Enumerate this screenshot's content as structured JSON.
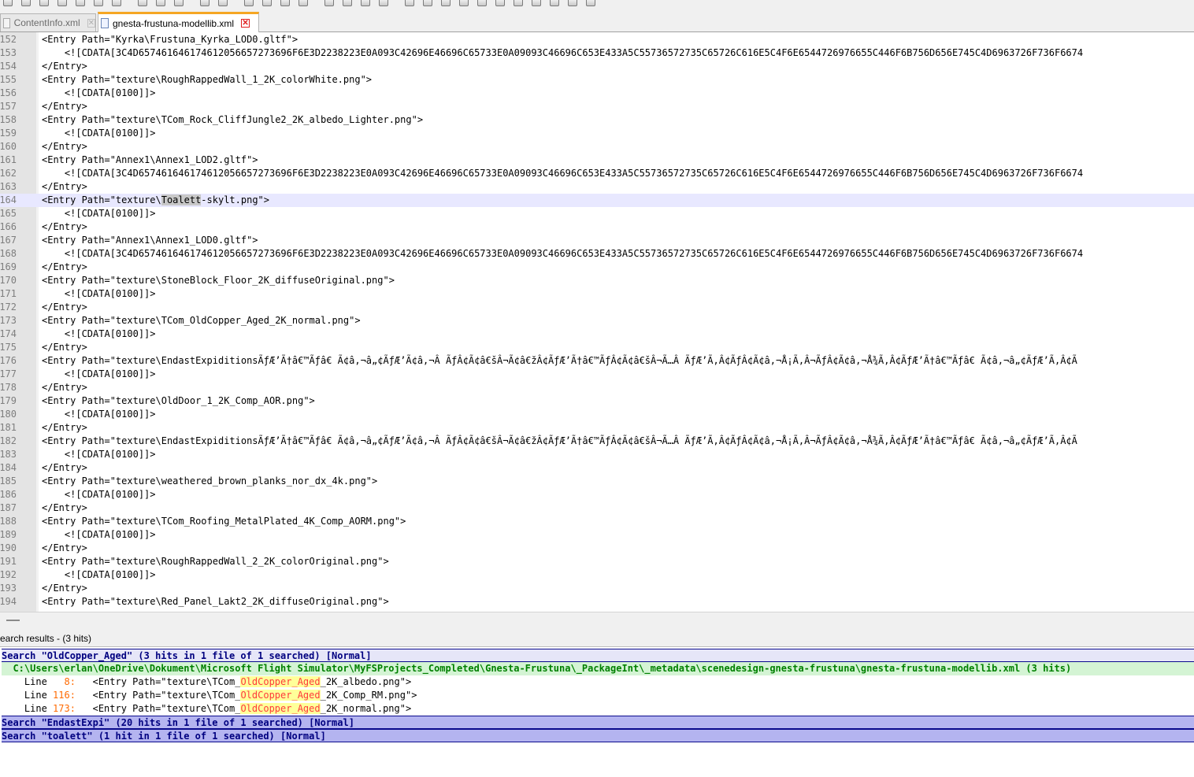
{
  "tabs": [
    {
      "label": "ContentInfo.xml",
      "active": false
    },
    {
      "label": "gnesta-frustuna-modellib.xml",
      "active": true
    }
  ],
  "toolbar_icons": [
    "new-file-icon",
    "open-file-icon",
    "save-icon",
    "save-all-icon",
    "close-icon",
    "close-all-icon",
    "print-icon",
    "cut-icon",
    "copy-icon",
    "paste-icon",
    "undo-icon",
    "redo-icon",
    "find-icon",
    "replace-icon",
    "zoom-in-icon",
    "zoom-out-icon",
    "sync-v-icon",
    "sync-h-icon",
    "word-wrap-icon",
    "all-chars-icon",
    "indent-guide-icon",
    "lang-icon",
    "doc-map-icon",
    "function-list-icon",
    "folder-icon",
    "monitor-icon",
    "record-icon",
    "stop-icon",
    "play-icon",
    "play-multiple-icon",
    "save-macro-icon"
  ],
  "editor": {
    "lines": [
      {
        "num": "152",
        "code": "<Entry Path=\"Kyrka\\Frustuna_Kyrka_LOD0.gltf\">"
      },
      {
        "num": "153",
        "code": "    <![CDATA[3C4D657461646174612056657273696F6E3D2238223E0A093C42696E46696C65733E0A09093C46696C653E433A5C55736572735C65726C616E5C4F6E6544726976655C446F6B756D656E745C4D6963726F736F6674"
      },
      {
        "num": "154",
        "code": "</Entry>"
      },
      {
        "num": "155",
        "code": "<Entry Path=\"texture\\RoughRappedWall_1_2K_colorWhite.png\">"
      },
      {
        "num": "156",
        "code": "    <![CDATA[0100]]>"
      },
      {
        "num": "157",
        "code": "</Entry>"
      },
      {
        "num": "158",
        "code": "<Entry Path=\"texture\\TCom_Rock_CliffJungle2_2K_albedo_Lighter.png\">"
      },
      {
        "num": "159",
        "code": "    <![CDATA[0100]]>"
      },
      {
        "num": "160",
        "code": "</Entry>"
      },
      {
        "num": "161",
        "code": "<Entry Path=\"Annex1\\Annex1_LOD2.gltf\">"
      },
      {
        "num": "162",
        "code": "    <![CDATA[3C4D657461646174612056657273696F6E3D2238223E0A093C42696E46696C65733E0A09093C46696C653E433A5C55736572735C65726C616E5C4F6E6544726976655C446F6B756D656E745C4D6963726F736F6674"
      },
      {
        "num": "163",
        "code": "</Entry>"
      },
      {
        "num": "164",
        "code_pre": "<Entry Path=\"texture\\",
        "code_mark": "Toalett",
        "code_post": "-skylt.png\">",
        "current": true
      },
      {
        "num": "165",
        "code": "    <![CDATA[0100]]>"
      },
      {
        "num": "166",
        "code": "</Entry>"
      },
      {
        "num": "167",
        "code": "<Entry Path=\"Annex1\\Annex1_LOD0.gltf\">"
      },
      {
        "num": "168",
        "code": "    <![CDATA[3C4D657461646174612056657273696F6E3D2238223E0A093C42696E46696C65733E0A09093C46696C653E433A5C55736572735C65726C616E5C4F6E6544726976655C446F6B756D656E745C4D6963726F736F6674"
      },
      {
        "num": "169",
        "code": "</Entry>"
      },
      {
        "num": "170",
        "code": "<Entry Path=\"texture\\StoneBlock_Floor_2K_diffuseOriginal.png\">"
      },
      {
        "num": "171",
        "code": "    <![CDATA[0100]]>"
      },
      {
        "num": "172",
        "code": "</Entry>"
      },
      {
        "num": "173",
        "code": "<Entry Path=\"texture\\TCom_OldCopper_Aged_2K_normal.png\">"
      },
      {
        "num": "174",
        "code": "    <![CDATA[0100]]>"
      },
      {
        "num": "175",
        "code": "</Entry>"
      },
      {
        "num": "176",
        "code": "<Entry Path=\"texture\\EndastExpiditionsÃƒÆ’Ã†â€™Ãƒâ€ Ã¢â‚¬â„¢ÃƒÆ’Ã¢â‚¬Â ÃƒÂ¢Ã¢â€šÂ¬Ã¢â€žÂ¢ÃƒÆ’Ã†â€™ÃƒÂ¢Ã¢â€šÂ¬Ã…Â ÃƒÆ’Ã‚Â¢ÃƒÂ¢Ã¢â‚¬Å¡Ã‚Â¬ÃƒÂ¢Ã¢â‚¬Å¾Ã‚Â¢ÃƒÆ’Ã†â€™Ãƒâ€ Ã¢â‚¬â„¢ÃƒÆ’Ã‚Â¢Ã"
      },
      {
        "num": "177",
        "code": "    <![CDATA[0100]]>"
      },
      {
        "num": "178",
        "code": "</Entry>"
      },
      {
        "num": "179",
        "code": "<Entry Path=\"texture\\OldDoor_1_2K_Comp_AOR.png\">"
      },
      {
        "num": "180",
        "code": "    <![CDATA[0100]]>"
      },
      {
        "num": "181",
        "code": "</Entry>"
      },
      {
        "num": "182",
        "code": "<Entry Path=\"texture\\EndastExpiditionsÃƒÆ’Ã†â€™Ãƒâ€ Ã¢â‚¬â„¢ÃƒÆ’Ã¢â‚¬Â ÃƒÂ¢Ã¢â€šÂ¬Ã¢â€žÂ¢ÃƒÆ’Ã†â€™ÃƒÂ¢Ã¢â€šÂ¬Ã…Â ÃƒÆ’Ã‚Â¢ÃƒÂ¢Ã¢â‚¬Å¡Ã‚Â¬ÃƒÂ¢Ã¢â‚¬Å¾Ã‚Â¢ÃƒÆ’Ã†â€™Ãƒâ€ Ã¢â‚¬â„¢ÃƒÆ’Ã‚Â¢Ã"
      },
      {
        "num": "183",
        "code": "    <![CDATA[0100]]>"
      },
      {
        "num": "184",
        "code": "</Entry>"
      },
      {
        "num": "185",
        "code": "<Entry Path=\"texture\\weathered_brown_planks_nor_dx_4k.png\">"
      },
      {
        "num": "186",
        "code": "    <![CDATA[0100]]>"
      },
      {
        "num": "187",
        "code": "</Entry>"
      },
      {
        "num": "188",
        "code": "<Entry Path=\"texture\\TCom_Roofing_MetalPlated_4K_Comp_AORM.png\">"
      },
      {
        "num": "189",
        "code": "    <![CDATA[0100]]>"
      },
      {
        "num": "190",
        "code": "</Entry>"
      },
      {
        "num": "191",
        "code": "<Entry Path=\"texture\\RoughRappedWall_2_2K_colorOriginal.png\">"
      },
      {
        "num": "192",
        "code": "    <![CDATA[0100]]>"
      },
      {
        "num": "193",
        "code": "</Entry>"
      },
      {
        "num": "194",
        "code": "<Entry Path=\"texture\\Red_Panel_Lakt2_2K_diffuseOriginal.png\">"
      }
    ]
  },
  "search_results": {
    "title": "earch results - (3 hits)",
    "searches": [
      {
        "header": "Search \"OldCopper_Aged\" (3 hits in 1 file of 1 searched) [Normal]",
        "expanded": true,
        "file": "  C:\\Users\\erlan\\OneDrive\\Dokument\\Microsoft Flight Simulator\\MyFSProjects_Completed\\Gnesta-Frustuna\\_PackageInt\\_metadata\\scenedesign-gnesta-frustuna\\gnesta-frustuna-modellib.xml (3 hits)",
        "hits": [
          {
            "label": "    Line ",
            "num": "  8:",
            "pre": "   <Entry Path=\"texture\\TCom_",
            "match": "OldCopper_Aged",
            "post": "_2K_albedo.png\">"
          },
          {
            "label": "    Line ",
            "num": "116:",
            "pre": "   <Entry Path=\"texture\\TCom_",
            "match": "OldCopper_Aged",
            "post": "_2K_Comp_RM.png\">"
          },
          {
            "label": "    Line ",
            "num": "173:",
            "pre": "   <Entry Path=\"texture\\TCom_",
            "match": "OldCopper_Aged",
            "post": "_2K_normal.png\">"
          }
        ]
      },
      {
        "header": "Search \"EndastExpi\" (20 hits in 1 file of 1 searched) [Normal]",
        "expanded": false
      },
      {
        "header": "Search \"toalett\" (1 hit in 1 file of 1 searched) [Normal]",
        "expanded": false
      }
    ]
  }
}
